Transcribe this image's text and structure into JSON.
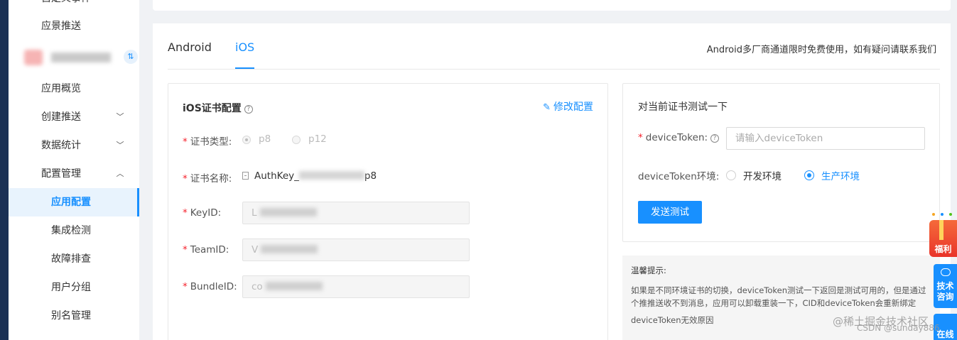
{
  "sidebar": {
    "top_partial": "自定义事件",
    "scene_push": "应景推送",
    "app_overview": "应用概览",
    "create_push": "创建推送",
    "data_stats": "数据统计",
    "config_manage": "配置管理",
    "sub_items": {
      "app_config": "应用配置",
      "integration_check": "集成检测",
      "troubleshoot": "故障排查",
      "user_group": "用户分组",
      "alias_manage": "别名管理"
    },
    "app_switch_icon": "switch-icon"
  },
  "tabs": {
    "android": "Android",
    "ios": "iOS"
  },
  "notice": "Android多厂商通道限时免费使用，如有疑问请联系我们",
  "cert_config": {
    "title": "iOS证书配置",
    "edit_label": "修改配置",
    "cert_type_label": "证书类型:",
    "cert_type_options": [
      "p8",
      "p12"
    ],
    "cert_name_label": "证书名称:",
    "cert_name_prefix": "AuthKey_",
    "cert_name_suffix": "p8",
    "key_id_label": "KeyID:",
    "key_id_value": "L",
    "team_id_label": "TeamID:",
    "team_id_value": "V",
    "bundle_id_label": "BundleID:",
    "bundle_id_value": "co"
  },
  "test": {
    "title": "对当前证书测试一下",
    "token_label": "deviceToken:",
    "token_placeholder": "请输入deviceToken",
    "env_label": "deviceToken环境:",
    "env_dev": "开发环境",
    "env_prod": "生产环境",
    "send_button": "发送测试"
  },
  "tips": {
    "title": "温馨提示:",
    "body": "如果是不同环境证书的切换，deviceToken测试一下返回是测试可用的，但是通过个推推送收不到消息，应用可以卸载重装一下，CID和deviceToken会重新绑定",
    "invalid_reason": "deviceToken无效原因"
  },
  "floats": {
    "gift": "福利",
    "support_line1": "技术",
    "support_line2": "咨询",
    "online": "在线"
  },
  "watermark": {
    "line1": "@稀土掘金技术社区",
    "line2": "CSDN @sunday886"
  },
  "colors": {
    "accent": "#1890ff",
    "navy": "#1b3154",
    "required": "#f5222d"
  }
}
